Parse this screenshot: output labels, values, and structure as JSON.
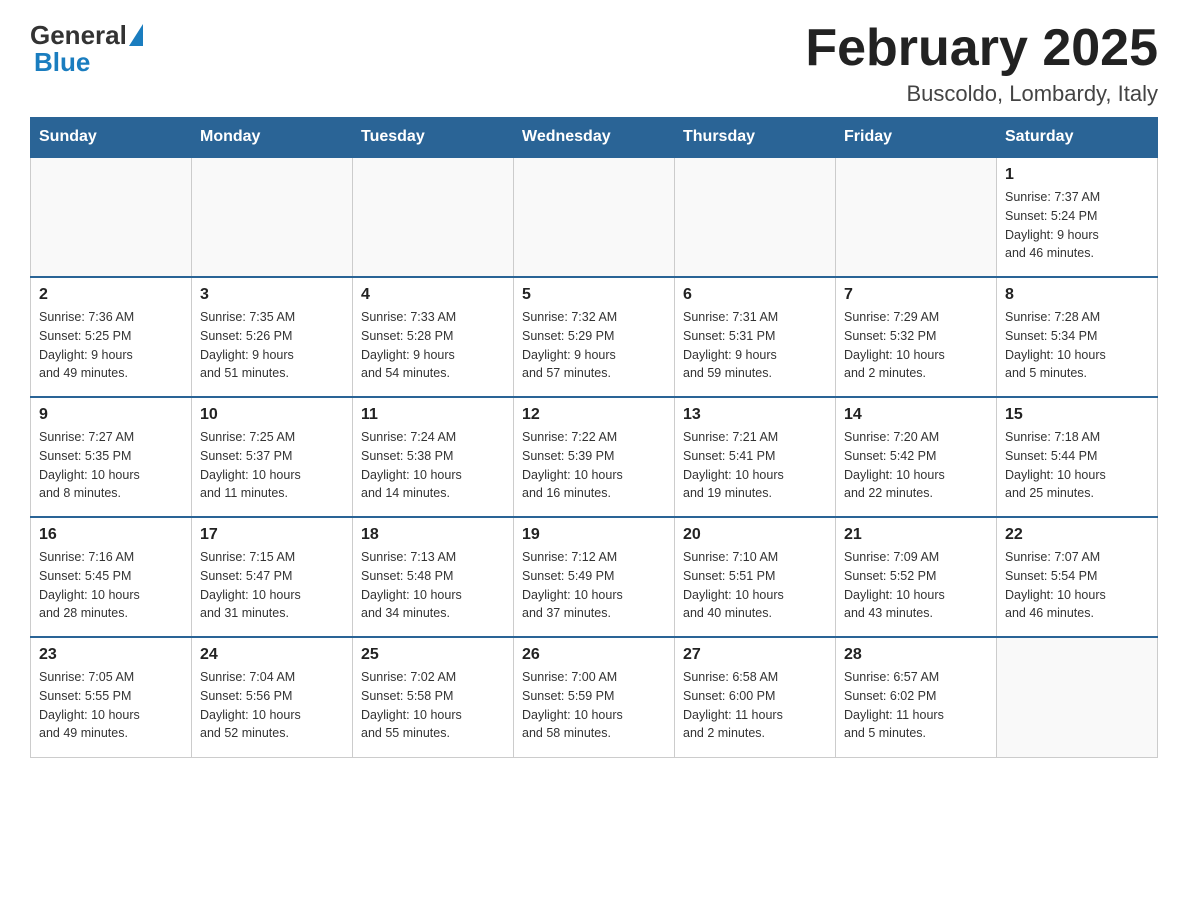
{
  "header": {
    "logo_general": "General",
    "logo_blue": "Blue",
    "month_title": "February 2025",
    "location": "Buscoldo, Lombardy, Italy"
  },
  "weekdays": [
    "Sunday",
    "Monday",
    "Tuesday",
    "Wednesday",
    "Thursday",
    "Friday",
    "Saturday"
  ],
  "weeks": [
    [
      {
        "day": "",
        "info": ""
      },
      {
        "day": "",
        "info": ""
      },
      {
        "day": "",
        "info": ""
      },
      {
        "day": "",
        "info": ""
      },
      {
        "day": "",
        "info": ""
      },
      {
        "day": "",
        "info": ""
      },
      {
        "day": "1",
        "info": "Sunrise: 7:37 AM\nSunset: 5:24 PM\nDaylight: 9 hours\nand 46 minutes."
      }
    ],
    [
      {
        "day": "2",
        "info": "Sunrise: 7:36 AM\nSunset: 5:25 PM\nDaylight: 9 hours\nand 49 minutes."
      },
      {
        "day": "3",
        "info": "Sunrise: 7:35 AM\nSunset: 5:26 PM\nDaylight: 9 hours\nand 51 minutes."
      },
      {
        "day": "4",
        "info": "Sunrise: 7:33 AM\nSunset: 5:28 PM\nDaylight: 9 hours\nand 54 minutes."
      },
      {
        "day": "5",
        "info": "Sunrise: 7:32 AM\nSunset: 5:29 PM\nDaylight: 9 hours\nand 57 minutes."
      },
      {
        "day": "6",
        "info": "Sunrise: 7:31 AM\nSunset: 5:31 PM\nDaylight: 9 hours\nand 59 minutes."
      },
      {
        "day": "7",
        "info": "Sunrise: 7:29 AM\nSunset: 5:32 PM\nDaylight: 10 hours\nand 2 minutes."
      },
      {
        "day": "8",
        "info": "Sunrise: 7:28 AM\nSunset: 5:34 PM\nDaylight: 10 hours\nand 5 minutes."
      }
    ],
    [
      {
        "day": "9",
        "info": "Sunrise: 7:27 AM\nSunset: 5:35 PM\nDaylight: 10 hours\nand 8 minutes."
      },
      {
        "day": "10",
        "info": "Sunrise: 7:25 AM\nSunset: 5:37 PM\nDaylight: 10 hours\nand 11 minutes."
      },
      {
        "day": "11",
        "info": "Sunrise: 7:24 AM\nSunset: 5:38 PM\nDaylight: 10 hours\nand 14 minutes."
      },
      {
        "day": "12",
        "info": "Sunrise: 7:22 AM\nSunset: 5:39 PM\nDaylight: 10 hours\nand 16 minutes."
      },
      {
        "day": "13",
        "info": "Sunrise: 7:21 AM\nSunset: 5:41 PM\nDaylight: 10 hours\nand 19 minutes."
      },
      {
        "day": "14",
        "info": "Sunrise: 7:20 AM\nSunset: 5:42 PM\nDaylight: 10 hours\nand 22 minutes."
      },
      {
        "day": "15",
        "info": "Sunrise: 7:18 AM\nSunset: 5:44 PM\nDaylight: 10 hours\nand 25 minutes."
      }
    ],
    [
      {
        "day": "16",
        "info": "Sunrise: 7:16 AM\nSunset: 5:45 PM\nDaylight: 10 hours\nand 28 minutes."
      },
      {
        "day": "17",
        "info": "Sunrise: 7:15 AM\nSunset: 5:47 PM\nDaylight: 10 hours\nand 31 minutes."
      },
      {
        "day": "18",
        "info": "Sunrise: 7:13 AM\nSunset: 5:48 PM\nDaylight: 10 hours\nand 34 minutes."
      },
      {
        "day": "19",
        "info": "Sunrise: 7:12 AM\nSunset: 5:49 PM\nDaylight: 10 hours\nand 37 minutes."
      },
      {
        "day": "20",
        "info": "Sunrise: 7:10 AM\nSunset: 5:51 PM\nDaylight: 10 hours\nand 40 minutes."
      },
      {
        "day": "21",
        "info": "Sunrise: 7:09 AM\nSunset: 5:52 PM\nDaylight: 10 hours\nand 43 minutes."
      },
      {
        "day": "22",
        "info": "Sunrise: 7:07 AM\nSunset: 5:54 PM\nDaylight: 10 hours\nand 46 minutes."
      }
    ],
    [
      {
        "day": "23",
        "info": "Sunrise: 7:05 AM\nSunset: 5:55 PM\nDaylight: 10 hours\nand 49 minutes."
      },
      {
        "day": "24",
        "info": "Sunrise: 7:04 AM\nSunset: 5:56 PM\nDaylight: 10 hours\nand 52 minutes."
      },
      {
        "day": "25",
        "info": "Sunrise: 7:02 AM\nSunset: 5:58 PM\nDaylight: 10 hours\nand 55 minutes."
      },
      {
        "day": "26",
        "info": "Sunrise: 7:00 AM\nSunset: 5:59 PM\nDaylight: 10 hours\nand 58 minutes."
      },
      {
        "day": "27",
        "info": "Sunrise: 6:58 AM\nSunset: 6:00 PM\nDaylight: 11 hours\nand 2 minutes."
      },
      {
        "day": "28",
        "info": "Sunrise: 6:57 AM\nSunset: 6:02 PM\nDaylight: 11 hours\nand 5 minutes."
      },
      {
        "day": "",
        "info": ""
      }
    ]
  ]
}
